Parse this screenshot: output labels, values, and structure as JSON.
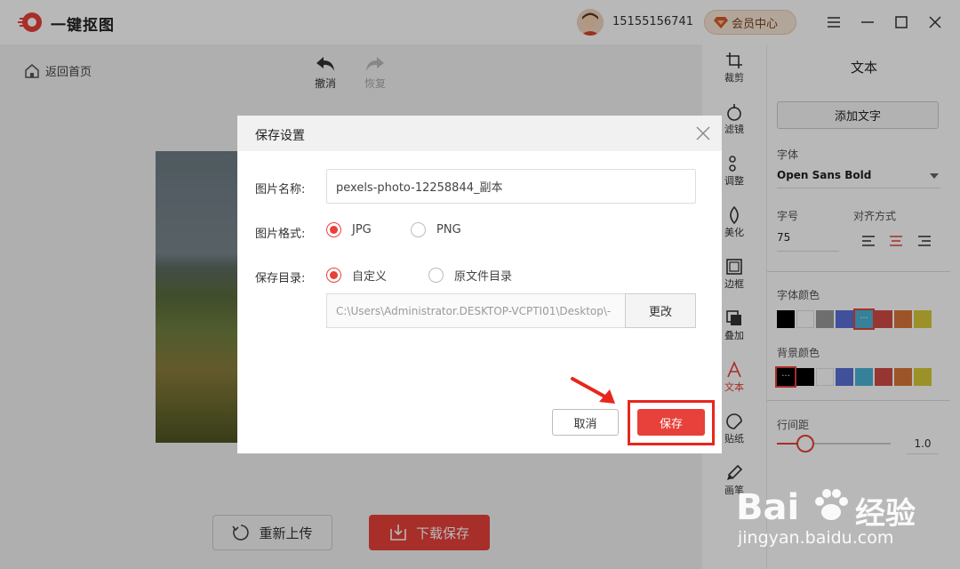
{
  "app": {
    "name": "一键抠图",
    "phone": "15155156741",
    "member_label": "会员中心"
  },
  "nav": {
    "back_home": "返回首页",
    "undo": "撤消",
    "redo": "恢复"
  },
  "actions": {
    "reupload": "重新上传",
    "download_save": "下载保存"
  },
  "toolbar": {
    "items": [
      {
        "label": "裁剪",
        "icon": "crop-icon"
      },
      {
        "label": "滤镜",
        "icon": "filter-icon"
      },
      {
        "label": "调整",
        "icon": "adjust-icon"
      },
      {
        "label": "美化",
        "icon": "beautify-icon"
      },
      {
        "label": "边框",
        "icon": "frame-icon"
      },
      {
        "label": "叠加",
        "icon": "overlay-icon"
      },
      {
        "label": "文本",
        "icon": "text-icon",
        "active": true
      },
      {
        "label": "贴纸",
        "icon": "sticker-icon"
      },
      {
        "label": "画笔",
        "icon": "brush-icon"
      }
    ]
  },
  "panel": {
    "title": "文本",
    "add_text": "添加文字",
    "font_label": "字体",
    "font_value": "Open Sans Bold",
    "size_label": "字号",
    "size_value": "75",
    "align_label": "对齐方式",
    "font_color_label": "字体颜色",
    "font_colors": [
      "#000000",
      "#ffffff",
      "#999999",
      "#5b6fd6",
      "#4ab3d6",
      "#d14a46",
      "#d9773a",
      "#d9c93a"
    ],
    "bg_color_label": "背景颜色",
    "bg_colors": [
      "#000000",
      "#000000",
      "#ffffff",
      "#5b6fd6",
      "#4ab3d6",
      "#d14a46",
      "#d9773a",
      "#d9c93a"
    ],
    "line_spacing_label": "行间距",
    "line_spacing_value": "1.0",
    "line_spacing_level": 0.25
  },
  "dialog": {
    "title": "保存设置",
    "name_label": "图片名称:",
    "name_value": "pexels-photo-12258844_副本",
    "format_label": "图片格式:",
    "format_jpg": "JPG",
    "format_png": "PNG",
    "dir_label": "保存目录:",
    "dir_custom": "自定义",
    "dir_original": "原文件目录",
    "path_value": "C:\\Users\\Administrator.DESKTOP-VCPTI01\\Desktop\\-",
    "change": "更改",
    "cancel": "取消",
    "save": "保存"
  },
  "watermark": {
    "brand": "Bai",
    "brand2": "经验",
    "url": "jingyan.baidu.com"
  }
}
